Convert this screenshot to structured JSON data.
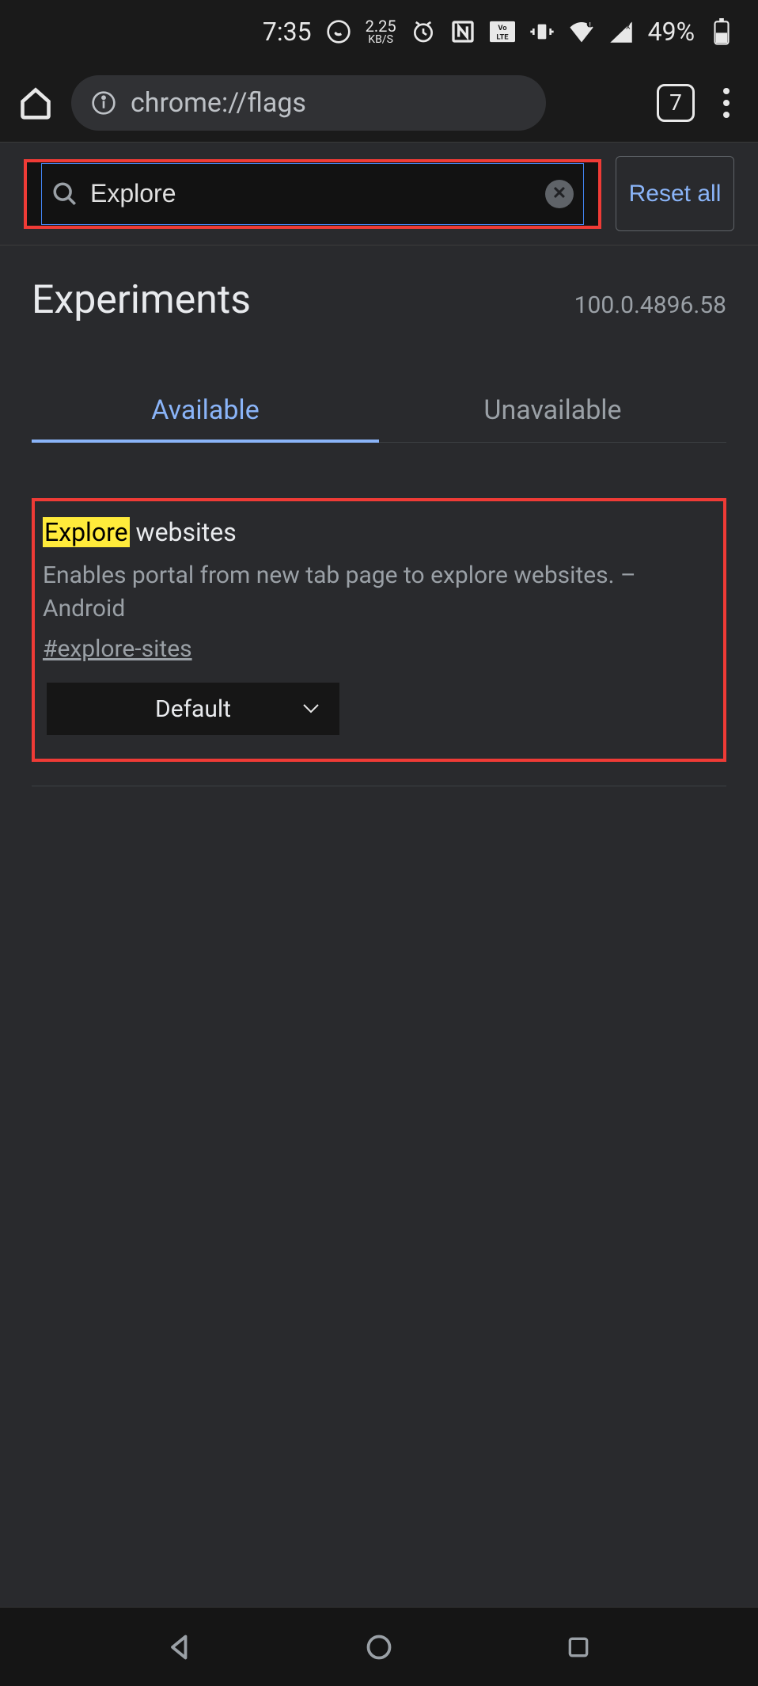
{
  "status_bar": {
    "time": "7:35",
    "data_rate_top": "2.25",
    "data_rate_bottom": "KB/S",
    "battery_pct": "49%"
  },
  "browser": {
    "url": "chrome://flags",
    "tab_count": "7"
  },
  "search": {
    "value": "Explore",
    "reset_label": "Reset all"
  },
  "page": {
    "title": "Experiments",
    "version": "100.0.4896.58",
    "tabs": {
      "available": "Available",
      "unavailable": "Unavailable"
    }
  },
  "flag": {
    "title_highlight": "Explore",
    "title_rest": " websites",
    "description": "Enables portal from new tab page to explore websites. – Android",
    "anchor": "#explore-sites",
    "select_value": "Default"
  }
}
